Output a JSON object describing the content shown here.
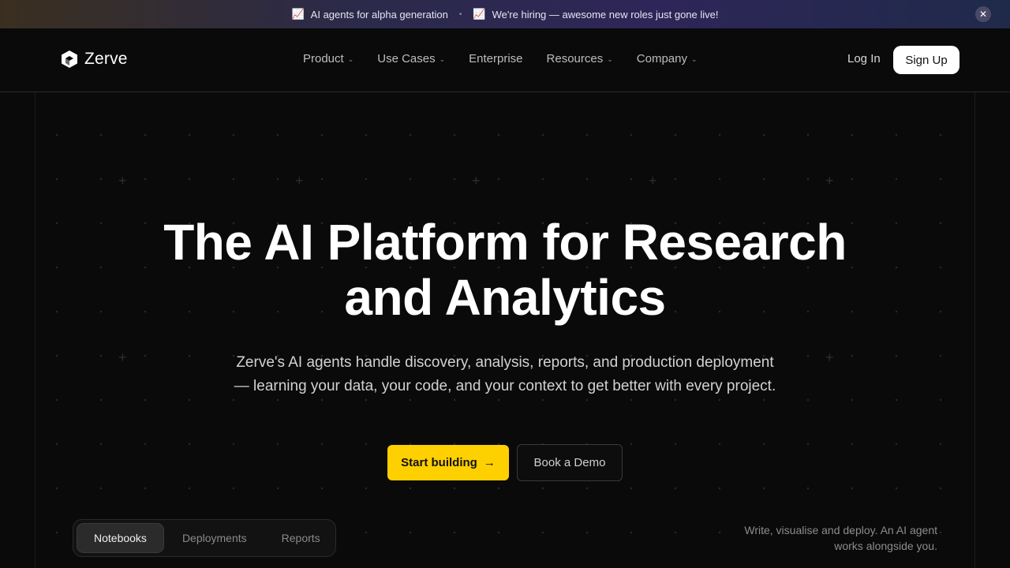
{
  "announcement": {
    "items": [
      {
        "icon": "chart-up-emoji",
        "text": "AI agents for alpha generation"
      },
      {
        "icon": "chart-up-emoji",
        "text": "We're hiring — awesome new roles just gone live!"
      }
    ],
    "close_symbol": "✕"
  },
  "nav": {
    "brand": "Zerve",
    "menu": [
      {
        "label": "Product",
        "has_dropdown": true
      },
      {
        "label": "Use Cases",
        "has_dropdown": true
      },
      {
        "label": "Enterprise",
        "has_dropdown": false
      },
      {
        "label": "Resources",
        "has_dropdown": true
      },
      {
        "label": "Company",
        "has_dropdown": true
      }
    ],
    "login": "Log In",
    "signup": "Sign Up"
  },
  "hero": {
    "headline_line1": "The AI Platform for Research",
    "headline_line2": "and Analytics",
    "subheading": "Zerve's AI agents handle discovery, analysis, reports, and production deployment — learning your data, your code, and your context to get better with every project.",
    "cta_primary": "Start building",
    "cta_primary_arrow": "→",
    "cta_secondary": "Book a Demo"
  },
  "showcase": {
    "tabs": [
      {
        "label": "Notebooks",
        "active": true
      },
      {
        "label": "Deployments",
        "active": false
      },
      {
        "label": "Reports",
        "active": false
      }
    ],
    "tagline": "Write, visualise and deploy. An AI agent works alongside you."
  },
  "colors": {
    "accent": "#ffd000",
    "background": "#0a0a0a"
  }
}
